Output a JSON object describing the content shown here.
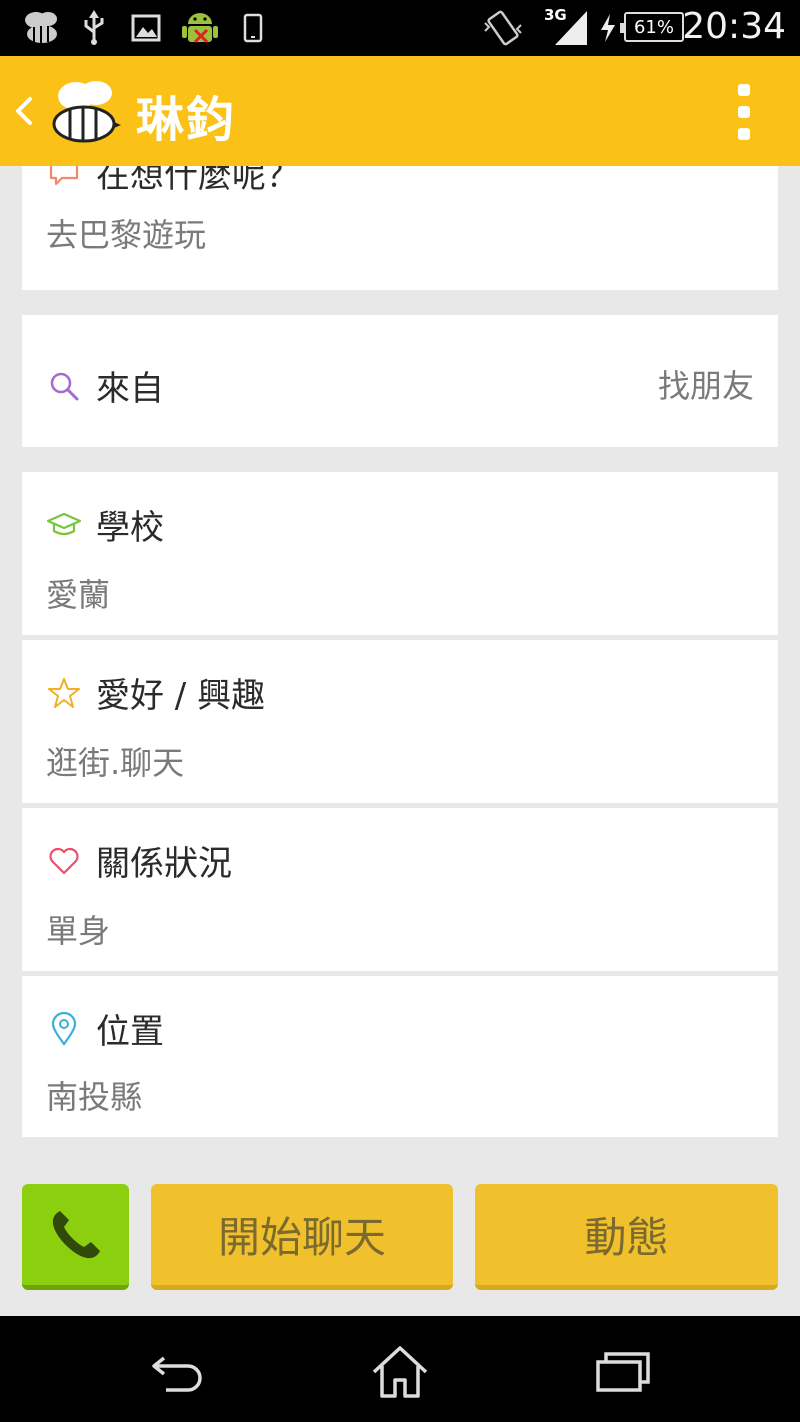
{
  "status_bar": {
    "network": "3G",
    "battery": "61%",
    "time": "20:34"
  },
  "app_bar": {
    "title": "琳鈞"
  },
  "status_card": {
    "label": "在想什麼呢？",
    "value": "去巴黎遊玩"
  },
  "from_card": {
    "label": "來自",
    "action": "找朋友"
  },
  "school_card": {
    "label": "學校",
    "value": "愛蘭"
  },
  "hobby_card": {
    "label": "愛好 / 興趣",
    "value": "逛街.聊天"
  },
  "relationship_card": {
    "label": "關係狀況",
    "value": "單身"
  },
  "location_card": {
    "label": "位置",
    "value": "南投縣"
  },
  "actions": {
    "chat_label": "開始聊天",
    "feed_label": "動態"
  },
  "colors": {
    "brand_yellow": "#fbc117",
    "phone_green": "#8ccf0f",
    "button_yellow": "#f0c12c"
  }
}
